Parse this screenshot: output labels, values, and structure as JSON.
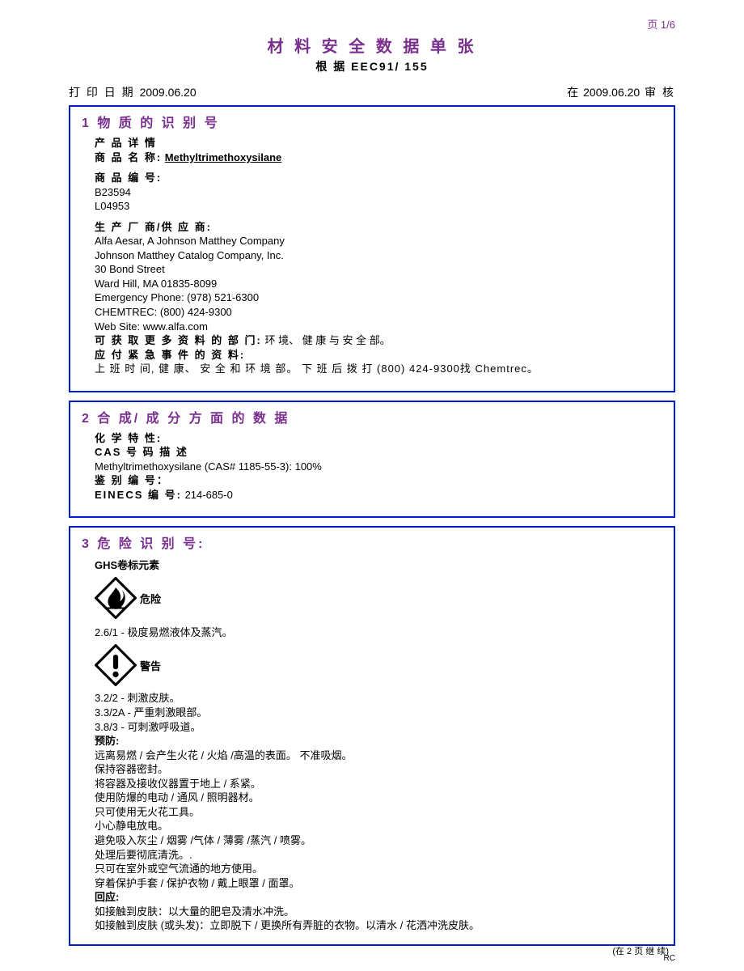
{
  "page": {
    "pagenum": "页 1/6",
    "title": "材 料 安 全 数 据 单 张",
    "subtitle": "根 据 EEC91/ 155",
    "print_label": "打 印 日 期",
    "print_date": "2009.06.20",
    "review_at": "在",
    "review_date": "2009.06.20",
    "review_suffix": "审 核",
    "continued": "(在 2 页 继 续)",
    "rc": "RC"
  },
  "s1": {
    "head": "1 物 质 的 识 别 号",
    "product_details": "产 品 详 情",
    "trade_name_label": "商 品 名 称:",
    "trade_name": "Methyltrimethoxysilane",
    "product_code_label": "商 品 编 号:",
    "code1": "B23594",
    "code2": "L04953",
    "supplier_label": "生 产 厂 商/供 应 商:",
    "supplier1": "Alfa Aesar, A Johnson Matthey Company",
    "supplier2": "Johnson Matthey Catalog Company, Inc.",
    "supplier3": "30 Bond Street",
    "supplier4": "Ward Hill, MA 01835-8099",
    "supplier5": "Emergency Phone: (978) 521-6300",
    "supplier6": "CHEMTREC: (800) 424-9300",
    "supplier7": "Web Site: www.alfa.com",
    "info_dept_label": "可 获 取 更 多 资 料 的 部 门:",
    "info_dept": " 环 境、 健 康 与 安 全 部。",
    "emergency_label": "应 付 紧 急 事 件 的 资 料:",
    "emergency": "上 班 时 间, 健 康、 安 全 和 环 境 部。 下 班 后 拨 打 (800) 424-9300找 Chemtrec。"
  },
  "s2": {
    "head": "2 合 成/ 成 分 方 面 的 数 据",
    "chem_label": "化 学 特 性:",
    "cas_label": "CAS 号 码 描 述",
    "cas_line": "Methyltrimethoxysilane (CAS# 1185-55-3): 100%",
    "id_label": "鉴 别 编 号：",
    "einecs_label": "EINECS 编 号:",
    "einecs": " 214-685-0"
  },
  "s3": {
    "head": "3 危 险 识 别 号:",
    "ghs_label": "GHS卷标元素",
    "danger": "危险",
    "danger_line": "2.6/1 - 极度易燃液体及蒸汽。",
    "warning": "警告",
    "w1": "3.2/2 - 刺激皮肤。",
    "w2": "3.3/2A - 严重刺激眼部。",
    "w3": "3.8/3 - 可刺激呼吸道。",
    "prevent_label": "预防:",
    "p1": "远离易燃 / 会产生火花 / 火焰 /高温的表面。 不准吸烟。",
    "p2": "保持容器密封。",
    "p3": "将容器及接收仪器置于地上 / 系紧。",
    "p4": "使用防爆的电动 / 通风 / 照明器材。",
    "p5": "只可使用无火花工具。",
    "p6": "小心静电放电。",
    "p7": "避免吸入灰尘 / 烟雾 /气体 / 薄雾 /蒸汽 / 喷雾。",
    "p8": "处理后要彻底清洗。.",
    "p9": "只可在室外或空气流通的地方使用。",
    "p10": "穿着保护手套 / 保护衣物 / 戴上眼罩 / 面罩。",
    "response_label": "回应:",
    "r1": "如接触到皮肤：以大量的肥皂及清水冲洗。",
    "r2": "如接触到皮肤 (或头发)：立即脱下 / 更换所有弄脏的衣物。以清水 / 花洒冲洗皮肤。"
  }
}
